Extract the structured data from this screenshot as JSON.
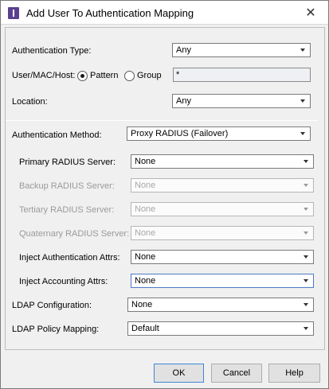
{
  "window": {
    "title": "Add User To Authentication Mapping",
    "close_glyph": "✕",
    "icon": "app-logo-icon"
  },
  "form": {
    "auth_type": {
      "label": "Authentication Type:",
      "value": "Any"
    },
    "user_mac_host": {
      "label": "User/MAC/Host:",
      "pattern_label": "Pattern",
      "group_label": "Group",
      "selected": "Pattern",
      "value": "*"
    },
    "location": {
      "label": "Location:",
      "value": "Any"
    },
    "auth_method": {
      "label": "Authentication Method:",
      "value": "Proxy RADIUS (Failover)"
    },
    "primary_radius": {
      "label": "Primary RADIUS Server:",
      "value": "None",
      "enabled": true
    },
    "backup_radius": {
      "label": "Backup RADIUS Server:",
      "value": "None",
      "enabled": false
    },
    "tertiary_radius": {
      "label": "Tertiary RADIUS Server:",
      "value": "None",
      "enabled": false
    },
    "quaternary_radius": {
      "label": "Quaternary RADIUS Server:",
      "value": "None",
      "enabled": false
    },
    "inject_auth_attrs": {
      "label": "Inject Authentication Attrs:",
      "value": "None",
      "enabled": true
    },
    "inject_acct_attrs": {
      "label": "Inject Accounting Attrs:",
      "value": "None",
      "enabled": true
    },
    "ldap_config": {
      "label": "LDAP Configuration:",
      "value": "None"
    },
    "ldap_policy": {
      "label": "LDAP Policy Mapping:",
      "value": "Default"
    }
  },
  "buttons": {
    "ok": "OK",
    "cancel": "Cancel",
    "help": "Help"
  },
  "colors": {
    "accent": "#5b3f8f",
    "focus": "#4a7bc8"
  }
}
